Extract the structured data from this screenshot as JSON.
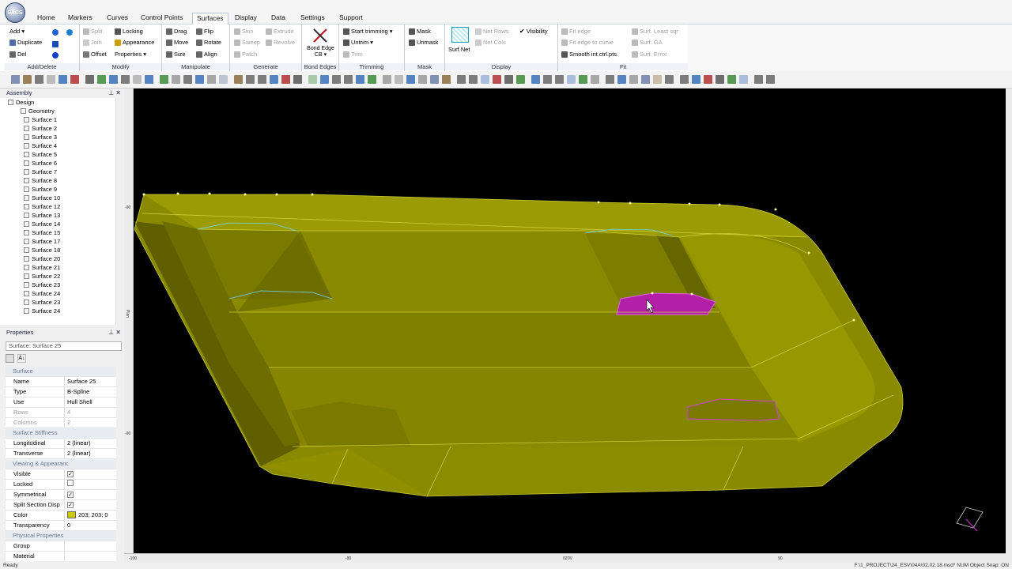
{
  "app": {
    "logo_text": "SACS"
  },
  "menu": {
    "tabs": [
      "Home",
      "Markers",
      "Curves",
      "Control Points",
      "Surfaces",
      "Display",
      "Data",
      "Settings",
      "Support"
    ],
    "active": "Surfaces"
  },
  "ribbon": {
    "add_delete": {
      "label": "Add/Delete",
      "add": "Add ▾",
      "duplicate": "Duplicate",
      "del": "Del"
    },
    "modify": {
      "label": "Modify",
      "split": "Split",
      "join": "Join",
      "offset": "Offset",
      "locking": "Locking",
      "appearance": "Appearance",
      "properties": "Properties ▾"
    },
    "manipulate": {
      "label": "Manipulate",
      "drag": "Drag",
      "flip": "Flip",
      "move": "Move",
      "rotate": "Rotate",
      "size": "Size",
      "align": "Align"
    },
    "generate": {
      "label": "Generate",
      "skin": "Skin",
      "extrude": "Extrude",
      "sweep": "Sweep",
      "revolve": "Revolve",
      "patch": "Patch"
    },
    "bond_edges": {
      "label": "Bond Edges",
      "button": "Bond Edge CB ▾"
    },
    "trimming": {
      "label": "Trimming",
      "start": "Start trimming ▾",
      "untrim": "Untrim ▾",
      "trim": "Trim"
    },
    "mask": {
      "label": "Mask",
      "mask": "Mask",
      "unmask": "Unmask"
    },
    "display": {
      "label": "Display",
      "surf_net": "Surf.Net",
      "net_rows": "Net Rows",
      "net_cols": "Net Cols",
      "visibility": "Visibility"
    },
    "fit": {
      "label": "Fit",
      "fit_edge": "Fit edge",
      "fit_edge_curve": "Fit edge to curve",
      "smooth": "Smooth int.ctrl.pts.",
      "least_sqr": "Surf. Least sqr",
      "ga": "Surf. GA",
      "error": "Surf. Error"
    }
  },
  "assembly": {
    "title": "Assembly",
    "root": "Design",
    "geometry": "Geometry",
    "surfaces": [
      "Surface 1",
      "Surface 2",
      "Surface 3",
      "Surface 4",
      "Surface 5",
      "Surface 6",
      "Surface 7",
      "Surface 8",
      "Surface 9",
      "Surface 10",
      "Surface 12",
      "Surface 13",
      "Surface 14",
      "Surface 15",
      "Surface 17",
      "Surface 18",
      "Surface 20",
      "Surface 21",
      "Surface 22",
      "Surface 23",
      "Surface 24",
      "Surface 23",
      "Surface 24"
    ]
  },
  "properties": {
    "title": "Properties",
    "selector": "Surface: Surface 25",
    "rows": [
      {
        "type": "cat",
        "k": "Surface"
      },
      {
        "k": "Name",
        "v": "Surface 25"
      },
      {
        "k": "Type",
        "v": "B-Spline"
      },
      {
        "k": "Use",
        "v": "Hull Shell"
      },
      {
        "k": "Rows",
        "v": "4",
        "dim": true
      },
      {
        "k": "Columns",
        "v": "2",
        "dim": true
      },
      {
        "type": "cat",
        "k": "Surface Stiffness"
      },
      {
        "k": "Longitudinal",
        "v": "2 (linear)"
      },
      {
        "k": "Transverse",
        "v": "2 (linear)"
      },
      {
        "type": "cat",
        "k": "Viewing & Appearance"
      },
      {
        "k": "Visible",
        "check": true
      },
      {
        "k": "Locked",
        "check": false
      },
      {
        "k": "Symmetrical",
        "check": true
      },
      {
        "k": "Split Section Disp",
        "check": true
      },
      {
        "k": "Color",
        "v": "203; 203; 0",
        "swatch": true
      },
      {
        "k": "Transparency",
        "v": "0"
      },
      {
        "type": "cat",
        "k": "Physical Properties"
      },
      {
        "k": "Group",
        "v": ""
      },
      {
        "k": "Material",
        "v": ""
      }
    ]
  },
  "colors": {
    "hull": "#8d8d00",
    "hull_light": "#a5a500",
    "hull_dark": "#5c5c00",
    "selected": "#b41fa8",
    "accent": "#cbcb00"
  },
  "rulers": {
    "bottom": [
      "-100",
      "-90",
      "0Z0V",
      "90"
    ],
    "left": [
      "-90",
      "Plan",
      "-90"
    ]
  },
  "status": {
    "left": "Ready",
    "right": "F:\\1_PROJECT\\24_ESV\\04A\\02.02.18.msd*    NUM   Object Snap: ON"
  }
}
